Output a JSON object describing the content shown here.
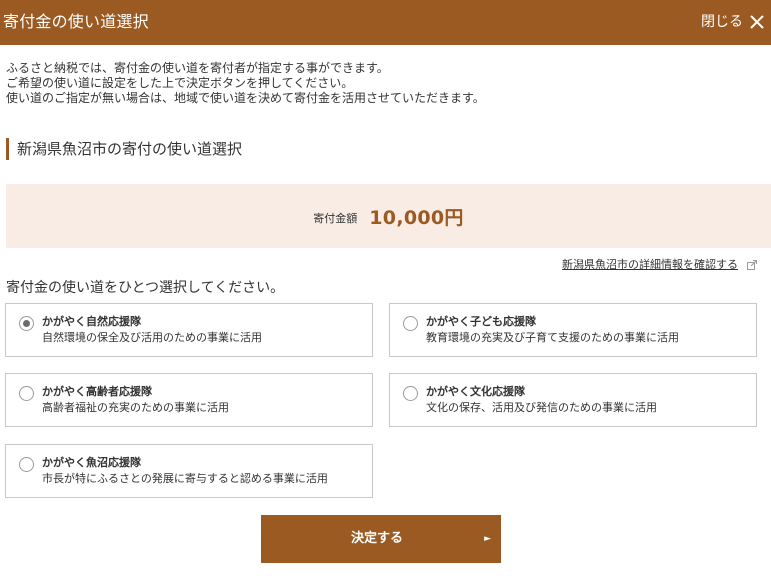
{
  "header": {
    "title": "寄付金の使い道選択",
    "close_label": "閉じる"
  },
  "intro": {
    "line1": "ふるさと納税では、寄付金の使い道を寄付者が指定する事ができます。",
    "line2": "ご希望の使い道に設定をした上で決定ボタンを押してください。",
    "line3": "使い道のご指定が無い場合は、地域で使い道を決めて寄付金を活用させていただきます。"
  },
  "section": {
    "title": "新潟県魚沼市の寄付の使い道選択"
  },
  "amount": {
    "label": "寄付金額",
    "value": "10,000円"
  },
  "detail_link": {
    "label": "新潟県魚沼市の詳細情報を確認する"
  },
  "instruction": "寄付金の使い道をひとつ選択してください。",
  "options": [
    {
      "title": "かがやく自然応援隊",
      "description": "自然環境の保全及び活用のための事業に活用",
      "selected": true
    },
    {
      "title": "かがやく子ども応援隊",
      "description": "教育環境の充実及び子育て支援のための事業に活用",
      "selected": false
    },
    {
      "title": "かがやく高齢者応援隊",
      "description": "高齢者福祉の充実のための事業に活用",
      "selected": false
    },
    {
      "title": "かがやく文化応援隊",
      "description": "文化の保存、活用及び発信のための事業に活用",
      "selected": false
    },
    {
      "title": "かがやく魚沼応援隊",
      "description": "市長が特にふるさとの発展に寄与すると認める事業に活用",
      "selected": false
    }
  ],
  "submit": {
    "label": "決定する"
  },
  "icons": {
    "close": "close-icon",
    "external_link": "external-link-icon",
    "submit_arrow": "arrow-right-icon"
  },
  "colors": {
    "brand": "#9a5a22",
    "amount_background": "#f8ece5",
    "border": "#c9c9c9"
  }
}
